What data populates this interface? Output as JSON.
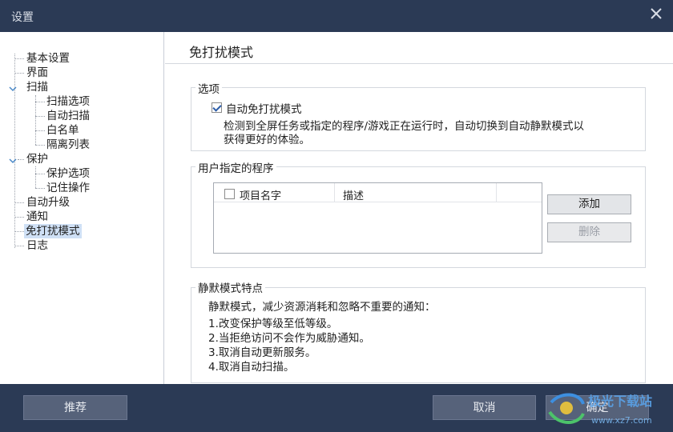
{
  "window": {
    "title": "设置",
    "close_icon": "close-icon"
  },
  "sidebar": {
    "items": [
      {
        "label": "基本设置"
      },
      {
        "label": "界面"
      },
      {
        "label": "扫描"
      },
      {
        "label": "扫描选项"
      },
      {
        "label": "自动扫描"
      },
      {
        "label": "白名单"
      },
      {
        "label": "隔离列表"
      },
      {
        "label": "保护"
      },
      {
        "label": "保护选项"
      },
      {
        "label": "记住操作"
      },
      {
        "label": "自动升级"
      },
      {
        "label": "通知"
      },
      {
        "label": "免打扰模式",
        "selected": true
      },
      {
        "label": "日志"
      }
    ]
  },
  "main": {
    "title": "免打扰模式",
    "options": {
      "label": "选项",
      "auto_label": "自动免打扰模式",
      "auto_checked": true,
      "desc_line1": "检测到全屏任务或指定的程序/游戏正在运行时，自动切换到自动静默模式以",
      "desc_line2": "获得更好的体验。"
    },
    "programs": {
      "label": "用户指定的程序",
      "columns": [
        "项目名字",
        "描述"
      ],
      "add_label": "添加",
      "delete_label": "删除"
    },
    "silent": {
      "label": "静默模式特点",
      "intro": "静默模式，减少资源消耗和忽略不重要的通知：",
      "items": [
        "1.改变保护等级至低等级。",
        "2.当拒绝访问不会作为威胁通知。",
        "3.取消自动更新服务。",
        "4.取消自动扫描。"
      ]
    }
  },
  "footer": {
    "recommend_label": "推荐",
    "cancel_label": "取消",
    "ok_label": "确定"
  },
  "watermark": {
    "text": "极光下载站",
    "url": "www.xz7.com"
  }
}
